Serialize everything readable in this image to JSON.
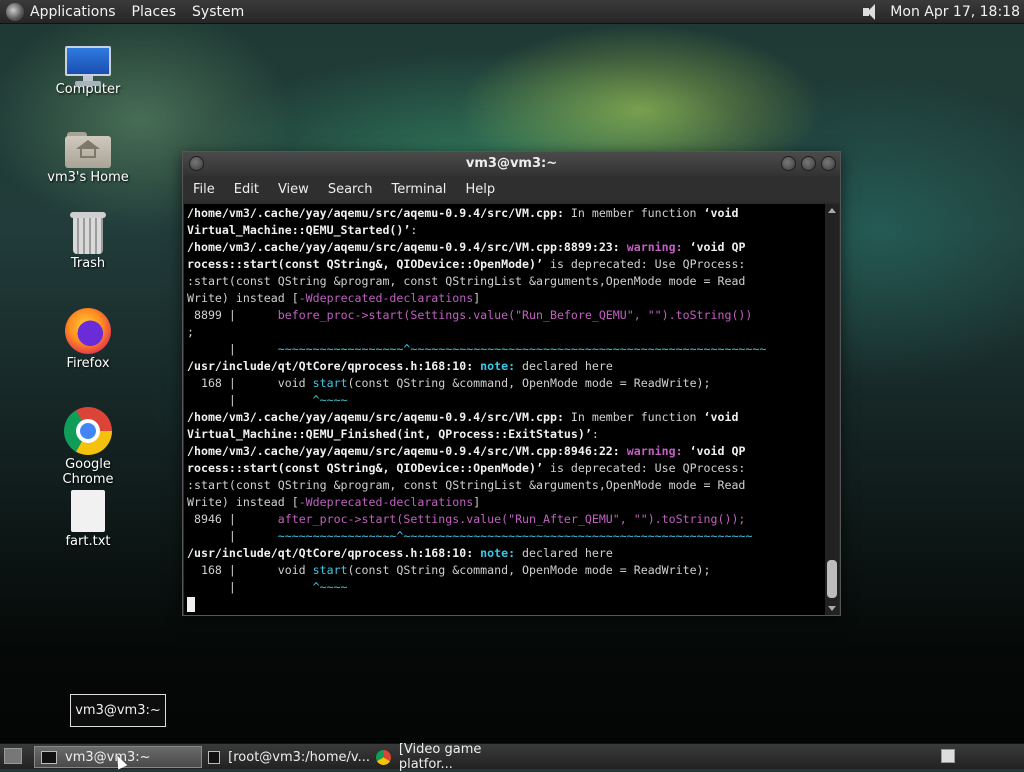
{
  "top_panel": {
    "menus": [
      "Applications",
      "Places",
      "System"
    ],
    "clock": "Mon Apr 17, 18:18"
  },
  "desktop_icons": [
    {
      "label": "Computer",
      "icon": "computer-icon"
    },
    {
      "label": "vm3's Home",
      "icon": "home-folder-icon"
    },
    {
      "label": "Trash",
      "icon": "trash-icon"
    },
    {
      "label": "Firefox",
      "icon": "firefox-icon"
    },
    {
      "label": "Google Chrome",
      "icon": "chrome-icon"
    },
    {
      "label": "fart.txt",
      "icon": "text-file-icon"
    }
  ],
  "terminal": {
    "title": "vm3@vm3:~",
    "menu": [
      "File",
      "Edit",
      "View",
      "Search",
      "Terminal",
      "Help"
    ],
    "lines": [
      [
        [
          "b",
          "/home/vm3/.cache/yay/aqemu/src/aqemu-0.9.4/src/VM.cpp:"
        ],
        [
          "t",
          " In member function "
        ],
        [
          "b",
          "‘void"
        ]
      ],
      [
        [
          "b",
          "Virtual_Machine::QEMU_Started()’"
        ],
        [
          "t",
          ":"
        ]
      ],
      [
        [
          "b",
          "/home/vm3/.cache/yay/aqemu/src/aqemu-0.9.4/src/VM.cpp:8899:23:"
        ],
        [
          "t",
          " "
        ],
        [
          "w",
          "warning:"
        ],
        [
          "t",
          " "
        ],
        [
          "b",
          "‘void QP"
        ]
      ],
      [
        [
          "b",
          "rocess::start(const QString&, QIODevice::OpenMode)’"
        ],
        [
          "t",
          " is deprecated: Use QProcess:"
        ]
      ],
      [
        [
          "t",
          ":start(const QString &program, const QStringList &arguments,OpenMode mode = Read"
        ]
      ],
      [
        [
          "t",
          "Write) instead ["
        ],
        [
          "c",
          "-Wdeprecated-declarations"
        ],
        [
          "t",
          "]"
        ]
      ],
      [
        [
          "t",
          " 8899 |      "
        ],
        [
          "c",
          "before_proc->start(Settings.value(\"Run_Before_QEMU\", \"\").toString())"
        ]
      ],
      [
        [
          "t",
          ";"
        ]
      ],
      [
        [
          "t",
          "      |      "
        ],
        [
          "s",
          "~~~~~~~~~~~~~~~~~~^~~~~~~~~~~~~~~~~~~~~~~~~~~~~~~~~~~~~~~~~~~~~~~~~~~~"
        ]
      ],
      [
        [
          "b",
          "/usr/include/qt/QtCore/qprocess.h:168:10:"
        ],
        [
          "t",
          " "
        ],
        [
          "n",
          "note:"
        ],
        [
          "t",
          " declared here"
        ]
      ],
      [
        [
          "t",
          "  168 |      void "
        ],
        [
          "s",
          "start"
        ],
        [
          "t",
          "(const QString &command, OpenMode mode = ReadWrite);"
        ]
      ],
      [
        [
          "t",
          "      |           "
        ],
        [
          "g",
          "^~~~~"
        ]
      ],
      [
        [
          "b",
          "/home/vm3/.cache/yay/aqemu/src/aqemu-0.9.4/src/VM.cpp:"
        ],
        [
          "t",
          " In member function "
        ],
        [
          "b",
          "‘void"
        ]
      ],
      [
        [
          "b",
          "Virtual_Machine::QEMU_Finished(int, QProcess::ExitStatus)’"
        ],
        [
          "t",
          ":"
        ]
      ],
      [
        [
          "b",
          "/home/vm3/.cache/yay/aqemu/src/aqemu-0.9.4/src/VM.cpp:8946:22:"
        ],
        [
          "t",
          " "
        ],
        [
          "w",
          "warning:"
        ],
        [
          "t",
          " "
        ],
        [
          "b",
          "‘void QP"
        ]
      ],
      [
        [
          "b",
          "rocess::start(const QString&, QIODevice::OpenMode)’"
        ],
        [
          "t",
          " is deprecated: Use QProcess:"
        ]
      ],
      [
        [
          "t",
          ":start(const QString &program, const QStringList &arguments,OpenMode mode = Read"
        ]
      ],
      [
        [
          "t",
          "Write) instead ["
        ],
        [
          "c",
          "-Wdeprecated-declarations"
        ],
        [
          "t",
          "]"
        ]
      ],
      [
        [
          "t",
          " 8946 |      "
        ],
        [
          "c",
          "after_proc->start(Settings.value(\"Run_After_QEMU\", \"\").toString());"
        ]
      ],
      [
        [
          "t",
          "      |      "
        ],
        [
          "s",
          "~~~~~~~~~~~~~~~~~^~~~~~~~~~~~~~~~~~~~~~~~~~~~~~~~~~~~~~~~~~~~~~~~~~~"
        ]
      ],
      [
        [
          "b",
          "/usr/include/qt/QtCore/qprocess.h:168:10:"
        ],
        [
          "t",
          " "
        ],
        [
          "n",
          "note:"
        ],
        [
          "t",
          " declared here"
        ]
      ],
      [
        [
          "t",
          "  168 |      void "
        ],
        [
          "s",
          "start"
        ],
        [
          "t",
          "(const QString &command, OpenMode mode = ReadWrite);"
        ]
      ],
      [
        [
          "t",
          "      |           "
        ],
        [
          "g",
          "^~~~~"
        ]
      ]
    ]
  },
  "tooltip": "vm3@vm3:~",
  "taskbar": {
    "tasks": [
      {
        "label": "vm3@vm3:~",
        "icon": "terminal-icon",
        "active": true
      },
      {
        "label": "[root@vm3:/home/v...",
        "icon": "terminal-icon",
        "active": false
      },
      {
        "label": "[Video game platfor...",
        "icon": "chrome-icon",
        "active": false
      }
    ]
  }
}
